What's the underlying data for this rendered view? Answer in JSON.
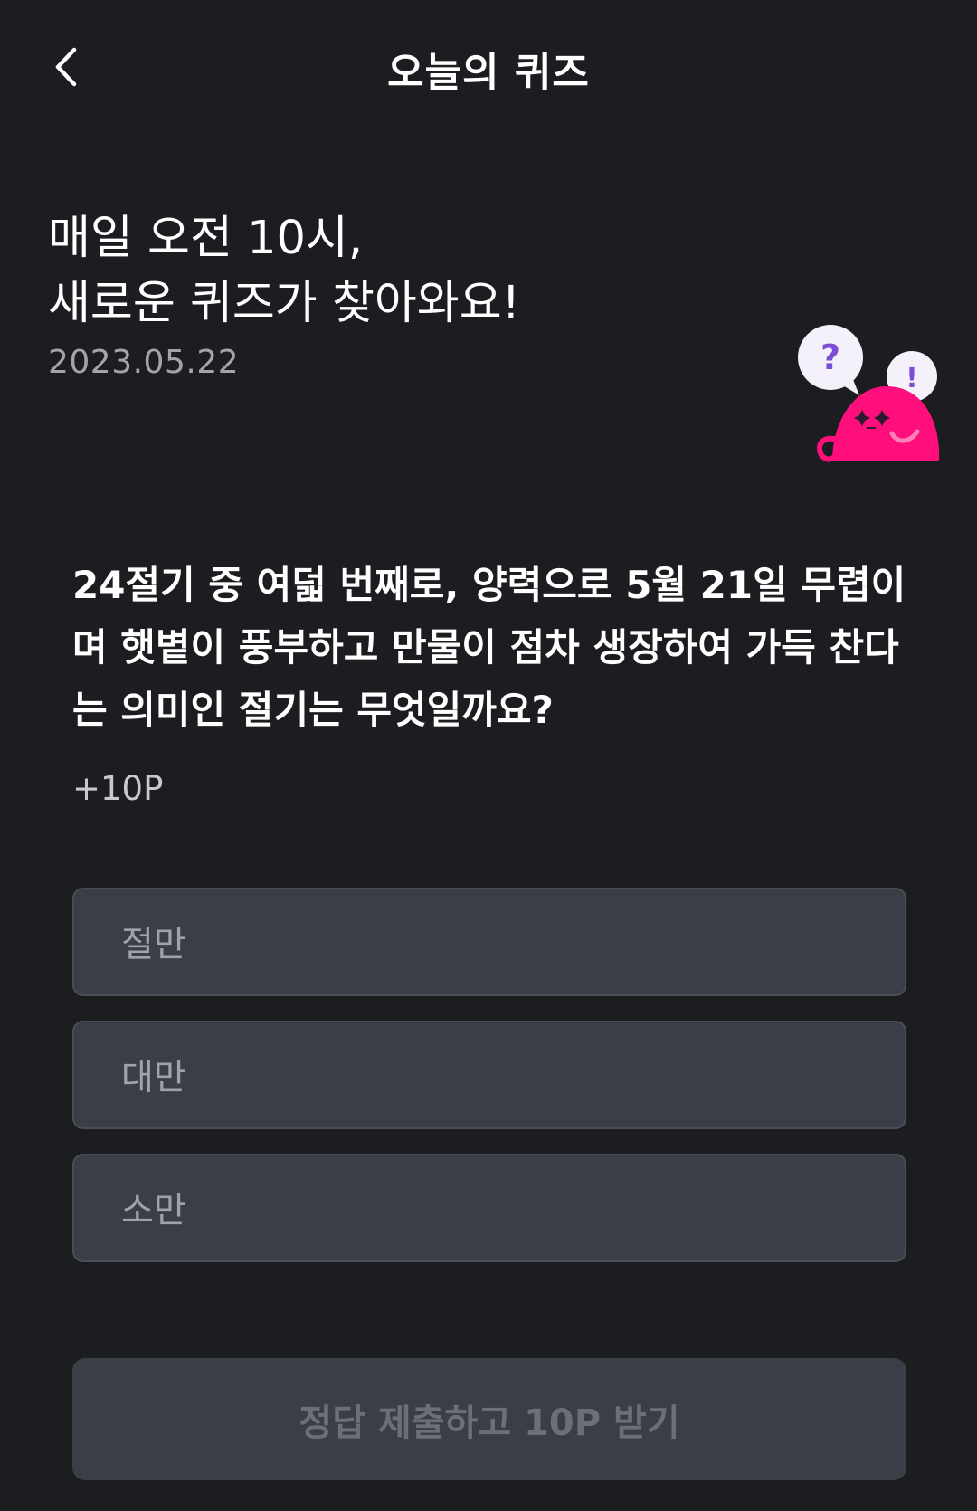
{
  "header": {
    "title": "오늘의 퀴즈",
    "back_icon": "chevron-left-icon"
  },
  "intro": {
    "title": "매일 오전 10시,\n새로운 퀴즈가 찾아와요!",
    "date": "2023.05.22"
  },
  "mascot": {
    "bubble_left": "?",
    "bubble_right": "!",
    "body_color": "#ff0f7b",
    "accent_color": "#7a4fd6"
  },
  "quiz": {
    "question": "24절기 중 여덟 번째로, 양력으로 5월 21일 무렵이며 햇볕이 풍부하고 만물이 점차 생장하여 가득 찬다는 의미인 절기는 무엇일까요?",
    "reward": "+10P",
    "options": [
      {
        "label": "절만"
      },
      {
        "label": "대만"
      },
      {
        "label": "소만"
      }
    ]
  },
  "submit": {
    "label": "정답 제출하고 10P 받기",
    "enabled": false
  },
  "colors": {
    "background": "#1c1d21",
    "option_bg": "#3b3e46",
    "brand_pink": "#ff0f7b"
  }
}
